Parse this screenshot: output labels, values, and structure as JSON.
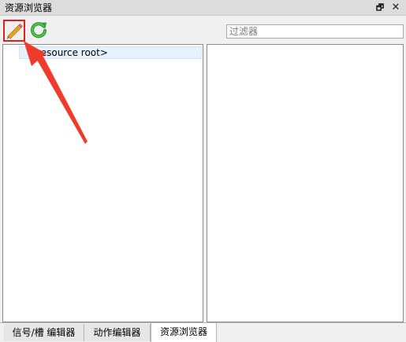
{
  "window": {
    "title": "资源浏览器",
    "float_glyph": "🗗",
    "close_glyph": "✕"
  },
  "toolbar": {
    "edit_icon": "pencil-icon",
    "refresh_icon": "refresh-icon",
    "filter_placeholder": "过滤器",
    "filter_value": ""
  },
  "tree": {
    "items": [
      {
        "label": "<resource root>",
        "selected": true
      }
    ]
  },
  "tabs": [
    {
      "label": "信号/槽 编辑器",
      "active": false
    },
    {
      "label": "动作编辑器",
      "active": false
    },
    {
      "label": "资源浏览器",
      "active": true
    }
  ],
  "colors": {
    "highlight_box": "#e02020",
    "annotation_arrow": "#f03a2a",
    "selection": "#e5f1fb",
    "refresh_green": "#2e9e2e"
  }
}
